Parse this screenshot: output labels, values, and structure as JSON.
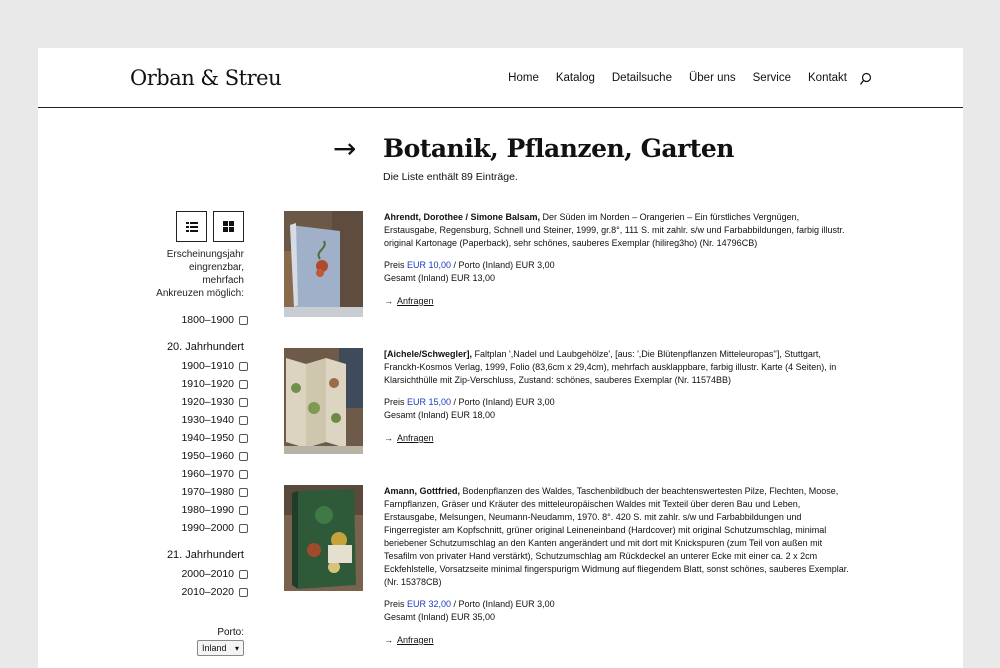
{
  "header": {
    "logo": "Orban & Streu",
    "nav": [
      "Home",
      "Katalog",
      "Detailsuche",
      "Über uns",
      "Service",
      "Kontakt"
    ]
  },
  "main": {
    "arrow": "→",
    "title": "Botanik, Pflanzen, Garten",
    "count_text": "Die Liste enthält 89 Einträge."
  },
  "sidebar": {
    "filter_note": [
      "Erscheinungsjahr",
      "eingrenzbar, mehrfach",
      "Ankreuzen möglich:"
    ],
    "early": "1800–1900",
    "century20": "20. Jahrhundert",
    "decades20": [
      "1900–1910",
      "1910–1920",
      "1920–1930",
      "1930–1940",
      "1940–1950",
      "1950–1960",
      "1960–1970",
      "1970–1980",
      "1980–1990",
      "1990–2000"
    ],
    "century21": "21. Jahrhundert",
    "decades21": [
      "2000–2010",
      "2010–2020"
    ],
    "porto_label": "Porto:",
    "porto_value": "Inland"
  },
  "entries": [
    {
      "author": "Ahrendt, Dorothee / Simone Balsam,",
      "desc": " Der Süden im Norden – Orangerien – Ein fürstliches Vergnügen, Erstausgabe, Regensburg, Schnell und Steiner, 1999, gr.8°, 111 S. mit zahlr. s/w und Farbabbildungen, farbig illustr. original Kartonage (Paperback), sehr schönes, sauberes Exemplar (hilireg3ho) (Nr. 14796CB)",
      "price_label": "Preis ",
      "price": "EUR 10,00",
      "porto": " / Porto (Inland) EUR 3,00",
      "total": "Gesamt (Inland) EUR 13,00",
      "inquire": "Anfragen"
    },
    {
      "author": "[Aichele/Schwegler],",
      "desc": " Faltplan ',Nadel und Laubgehölze', [aus: ',Die Blütenpflanzen Mitteleuropas''], Stuttgart, Franckh-Kosmos Verlag, 1999, Folio (83,6cm x 29,4cm), mehrfach ausklappbare, farbig illustr. Karte (4 Seiten), in Klarsichthülle mit Zip-Verschluss, Zustand: schönes, sauberes Exemplar (Nr. 11574BB)",
      "price_label": "Preis ",
      "price": "EUR 15,00",
      "porto": " / Porto (Inland) EUR 3,00",
      "total": "Gesamt (Inland) EUR 18,00",
      "inquire": "Anfragen"
    },
    {
      "author": "Amann, Gottfried,",
      "desc": " Bodenpflanzen des Waldes, Taschenbildbuch der beachtenswertesten Pilze, Flechten, Moose, Farnpflanzen, Gräser und Kräuter des mitteleuropäischen Waldes mit Texteil über deren Bau und Leben, Erstausgabe, Melsungen, Neumann-Neudamm, 1970. 8°. 420 S. mit zahlr. s/w und Farbabbildungen und Fingerregister am Kopfschnitt, grüner original Leineneinband (Hardcover) mit original Schutzumschlag, minimal beriebener Schutzumschlag an den Kanten angerändert und mit dort mit Knickspuren (zum Teil von außen mit Tesafilm von privater Hand verstärkt), Schutzumschlag am Rückdeckel an unterer Ecke mit einer ca. 2 x 2cm Eckfehlstelle, Vorsatzseite minimal fingerspurigm Widmung auf fliegendem Blatt, sonst schönes, sauberes Exemplar. (Nr. 15378CB)",
      "price_label": "Preis ",
      "price": "EUR 32,00",
      "porto": " / Porto (Inland) EUR 3,00",
      "total": "Gesamt (Inland) EUR 35,00",
      "inquire": "Anfragen"
    }
  ],
  "colors": {
    "accent": "#1a3bbf",
    "background": "#e9e9e9"
  }
}
